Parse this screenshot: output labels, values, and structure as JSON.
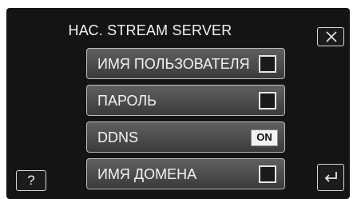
{
  "header": {
    "title": "НАС. STREAM SERVER",
    "close_icon": "close-icon"
  },
  "menu": {
    "items": [
      {
        "label": "ИМЯ ПОЛЬЗОВАТЕЛЯ",
        "control": "checkbox",
        "checked": false
      },
      {
        "label": "ПАРОЛЬ",
        "control": "checkbox",
        "checked": false
      },
      {
        "label": "DDNS",
        "control": "toggle",
        "value": "ON"
      },
      {
        "label": "ИМЯ ДОМЕНА",
        "control": "checkbox",
        "checked": false
      }
    ]
  },
  "footer": {
    "help_label": "?",
    "back_icon": "back-arrow-icon"
  },
  "colors": {
    "screen_bg": "#141414",
    "item_gradient_top": "#606060",
    "item_gradient_bottom": "#3a3a3a",
    "text": "#f2f2f2"
  }
}
